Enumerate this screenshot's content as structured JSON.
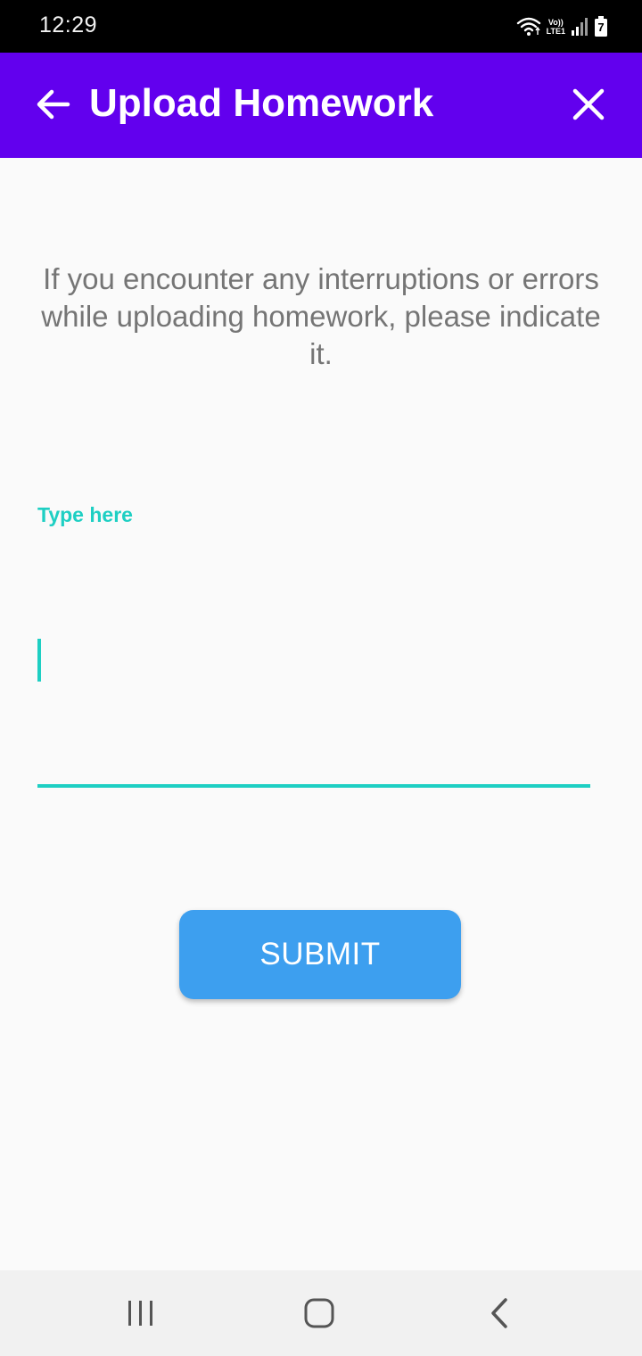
{
  "status_bar": {
    "time": "12:29",
    "network_top": "Vo))",
    "network_bottom": "LTE1",
    "battery_level": "7"
  },
  "app_bar": {
    "title": "Upload Homework",
    "background_color": "#6200ee"
  },
  "message": {
    "text": "If you encounter any interruptions or errors while uploading homework, please indicate it."
  },
  "feedback_field": {
    "label": "Type here",
    "value": "",
    "accent_color": "#1ecfc3"
  },
  "submit": {
    "label": "SUBMIT",
    "background_color": "#3d9fef"
  },
  "icons": {
    "back": "arrow-left-icon",
    "close": "close-icon",
    "wifi": "wifi-icon",
    "signal": "signal-icon",
    "battery": "battery-icon",
    "nav_recents": "recents-icon",
    "nav_home": "home-icon",
    "nav_back": "chevron-left-icon"
  }
}
